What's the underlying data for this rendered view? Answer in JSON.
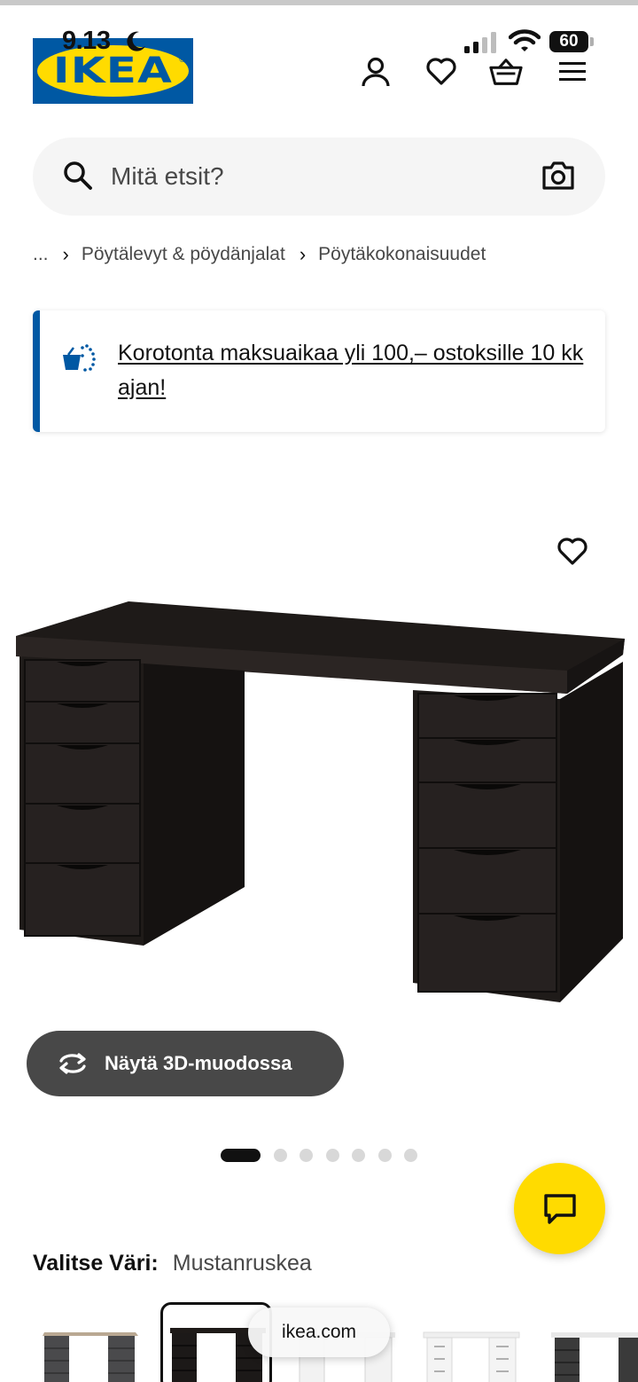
{
  "status_bar": {
    "time": "9.13",
    "battery": "60"
  },
  "brand": {
    "logo_text": "IKEA",
    "blue": "#0058a3",
    "yellow": "#ffdb00"
  },
  "header": {
    "icons": [
      "person-icon",
      "heart-icon",
      "basket-icon",
      "menu-icon"
    ]
  },
  "search": {
    "placeholder": "Mitä etsit?"
  },
  "breadcrumb": {
    "ellipsis": "...",
    "items": [
      "Pöytälevyt & pöydänjalat",
      "Pöytäkokonaisuudet"
    ]
  },
  "promo": {
    "text": "Korotonta maksuaikaa yli 100,– ostoksille 10 kk ajan!"
  },
  "view3d": {
    "label": "Näytä 3D-muodossa"
  },
  "carousel": {
    "count": 7,
    "active_index": 0
  },
  "color": {
    "label": "Valitse Väri:",
    "value": "Mustanruskea"
  },
  "swatches": [
    {
      "name": "gray-oak",
      "selected": false
    },
    {
      "name": "black-brown",
      "selected": true
    },
    {
      "name": "white-black",
      "selected": false
    },
    {
      "name": "white",
      "selected": false
    },
    {
      "name": "black-anthracite",
      "selected": false
    }
  ],
  "browser": {
    "url": "ikea.com"
  }
}
